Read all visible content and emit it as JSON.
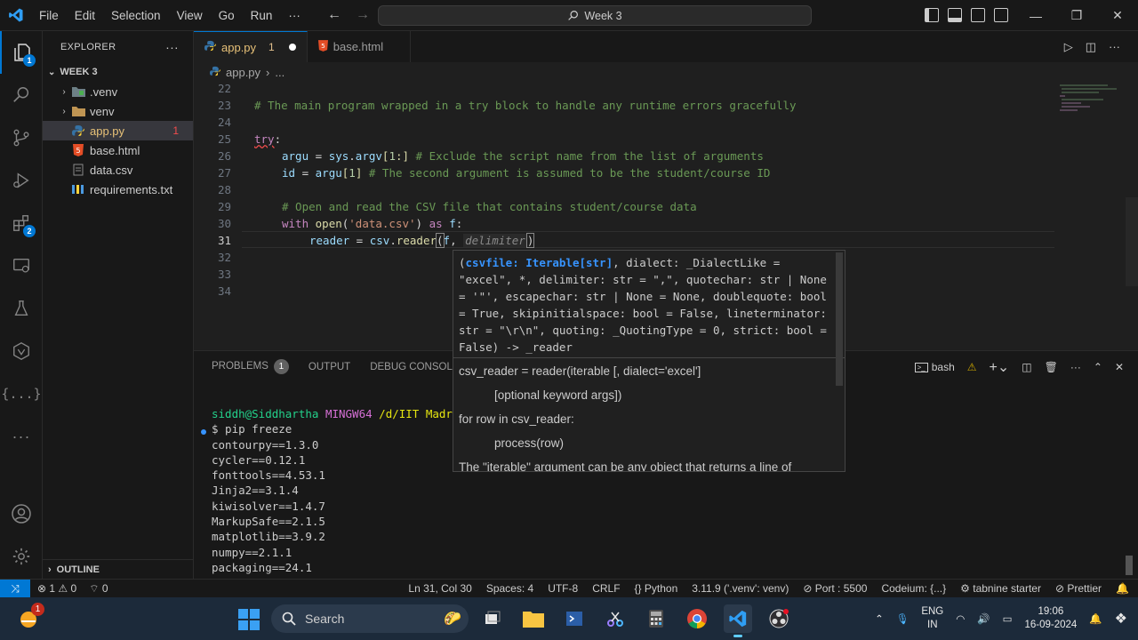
{
  "titlebar": {
    "menu": [
      "File",
      "Edit",
      "Selection",
      "View",
      "Go",
      "Run",
      "···"
    ],
    "search_text": "Week 3"
  },
  "activity": {
    "explorer_badge": "1",
    "extensions_badge": "2"
  },
  "sidebar": {
    "title": "EXPLORER",
    "folder": "WEEK 3",
    "items": [
      {
        "label": ".venv",
        "type": "folder"
      },
      {
        "label": "venv",
        "type": "folder"
      },
      {
        "label": "app.py",
        "type": "python",
        "count": "1"
      },
      {
        "label": "base.html",
        "type": "html"
      },
      {
        "label": "data.csv",
        "type": "csv"
      },
      {
        "label": "requirements.txt",
        "type": "txt"
      }
    ],
    "outline": "OUTLINE"
  },
  "tabs": [
    {
      "label": "app.py",
      "modified_count": "1"
    },
    {
      "label": "base.html"
    }
  ],
  "breadcrumb": {
    "file": "app.py",
    "rest": "..."
  },
  "editor": {
    "lines": [
      {
        "n": "22"
      },
      {
        "n": "23",
        "comment": "# The main program wrapped in a try block to handle any runtime errors gracefully"
      },
      {
        "n": "24"
      },
      {
        "n": "25",
        "kw": "try",
        "rest": ":"
      },
      {
        "n": "26",
        "a": "argu",
        "b": " = ",
        "c": "sys",
        "d": ".",
        "e": "argv",
        "f": "[",
        "g": "1",
        "h": ":] ",
        "comment": "# Exclude the script name from the list of arguments"
      },
      {
        "n": "27",
        "a": "id",
        "b": " = ",
        "c": "argu",
        "f": "[",
        "g": "1",
        "h": "] ",
        "comment": "# The second argument is assumed to be the student/course ID"
      },
      {
        "n": "28"
      },
      {
        "n": "29",
        "comment": "# Open and read the CSV file that contains student/course data"
      },
      {
        "n": "30",
        "kw": "with",
        "fn": "open",
        "str": "'data.csv'",
        "kw2": "as",
        "v": "f",
        "end": ":"
      },
      {
        "n": "31",
        "a": "reader",
        "b": " = ",
        "c": "csv",
        "d": ".",
        "fn": "reader",
        "arg": "f",
        "hint": "delimiter"
      },
      {
        "n": "32"
      },
      {
        "n": "33"
      },
      {
        "n": "34"
      }
    ]
  },
  "popup": {
    "signature_pre": "(",
    "signature_active": "csvfile: Iterable[str]",
    "signature_post": ", dialect: _DialectLike = \"excel\", *, delimiter: str = \",\", quotechar: str | None = '\"', escapechar: str | None = None, doublequote: bool = True, skipinitialspace: bool = False, lineterminator: str = \"\\r\\n\", quoting: _QuotingType = 0, strict: bool = False) -> _reader",
    "doc": [
      "csv_reader = reader(iterable [, dialect='excel']",
      "[optional keyword args])",
      "for row in csv_reader:",
      "process(row)",
      "The \"iterable\" argument can be any object that returns a line of"
    ]
  },
  "panel": {
    "tabs": [
      "PROBLEMS",
      "OUTPUT",
      "DEBUG CONSOLE"
    ],
    "problems_count": "1",
    "shell": "bash",
    "terminal": {
      "user": "siddh@Siddhartha",
      "host": "MINGW64",
      "path": "/d/IIT Madras",
      "command": "$ pip freeze",
      "output": [
        "contourpy==1.3.0",
        "cycler==0.12.1",
        "fonttools==4.53.1",
        "Jinja2==3.1.4",
        "kiwisolver==1.4.7",
        "MarkupSafe==2.1.5",
        "matplotlib==3.9.2",
        "numpy==2.1.1",
        "packaging==24.1"
      ]
    }
  },
  "status": {
    "errors": "1",
    "warnings": "0",
    "ports_count": "0",
    "position": "Ln 31, Col 30",
    "spaces": "Spaces: 4",
    "encoding": "UTF-8",
    "eol": "CRLF",
    "language": "Python",
    "interpreter": "3.11.9 ('.venv': venv)",
    "port": "Port : 5500",
    "codeium": "Codeium: {...}",
    "tabnine": "tabnine starter",
    "prettier": "Prettier"
  },
  "taskbar": {
    "weather_badge": "1",
    "search": "Search",
    "lang_top": "ENG",
    "lang_bottom": "IN",
    "time": "19:06",
    "date": "16-09-2024"
  },
  "colors": {
    "accent": "#0078d4",
    "comment": "#6a9955",
    "keyword": "#c586c0",
    "string": "#ce9178",
    "variable": "#9cdcfe",
    "function": "#dcdcaa"
  }
}
